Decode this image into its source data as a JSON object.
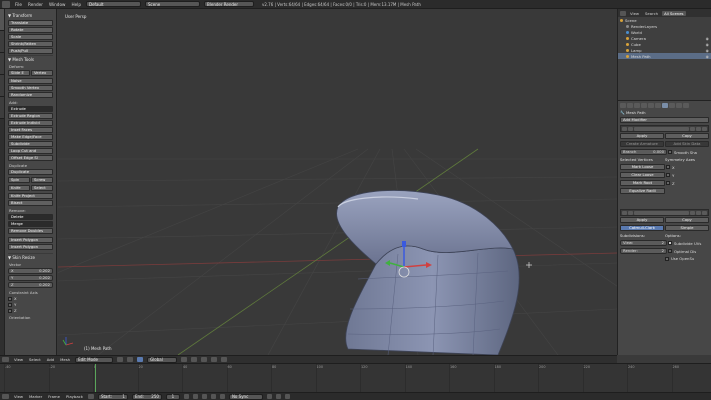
{
  "topbar": {
    "menus": [
      "File",
      "Render",
      "Window",
      "Help"
    ],
    "layout": "Default",
    "scene": "Scene",
    "engine": "Blender Render",
    "stats": "v2.76 | Verts:64/64 | Edges:64/64 | Faces:0/0 | Tris:0 | Mem:13.17M | Mesh Path"
  },
  "toolshelf": {
    "sections": {
      "transform": "▼ Transform",
      "mesh_tools": "▼ Mesh Tools",
      "deform": "Deform:",
      "add": "Add:",
      "duplicate": "Duplicate",
      "remove": "Remove:",
      "skin_resize": "▼ Skin Resize",
      "vector": "Vector",
      "constraint": "Constraint Axis",
      "orientation": "Orientation"
    },
    "transform_buttons": [
      "Translate",
      "Rotate",
      "Scale",
      "Shrink/Fatten",
      "Push/Pull"
    ],
    "deform_row1": [
      "Slide E",
      "Vertex"
    ],
    "deform_buttons": [
      "Noise",
      "Smooth Vertex",
      "Randomize"
    ],
    "add_buttons": [
      "Extrude",
      "Extrude Region",
      "Extrude Individ",
      "Inset Faces",
      "Make Edge/Face",
      "Subdivide",
      "Loop Cut and",
      "Offset Edge Sl"
    ],
    "dup_buttons": [
      "Duplicate"
    ],
    "spin_row": [
      "Spin",
      "Screw"
    ],
    "knife_row": [
      "Knife",
      "Select"
    ],
    "knife_buttons": [
      "Knife Project",
      "Bisect"
    ],
    "remove_buttons": [
      "Delete",
      "Merge",
      "Remove Doubles"
    ],
    "other_buttons": [
      "Insert Polygon",
      "Insert Polygon"
    ],
    "vector": [
      {
        "axis": "X",
        "value": "0.202"
      },
      {
        "axis": "Y",
        "value": "0.202"
      },
      {
        "axis": "Z",
        "value": "0.202"
      }
    ],
    "constraint_axes": [
      "X",
      "Y",
      "Z"
    ]
  },
  "viewport": {
    "view_label": "User Persp",
    "object_label": "(1) Mesh Path"
  },
  "outliner": {
    "tabs": [
      "View",
      "Search",
      "All Scenes"
    ],
    "rows": [
      {
        "label": "Scene",
        "sel": false
      },
      {
        "label": "RenderLayers",
        "sel": false
      },
      {
        "label": "World",
        "sel": false
      },
      {
        "label": "Camera",
        "sel": false
      },
      {
        "label": "Cube",
        "sel": false
      },
      {
        "label": "Lamp",
        "sel": false
      },
      {
        "label": "Mesh Path",
        "sel": true
      }
    ]
  },
  "properties": {
    "object_name": "Mesh Path",
    "add_modifier": "Add Modifier",
    "skin": {
      "apply": "Apply",
      "copy": "Copy",
      "create_armature": "Create Armature",
      "add_skin_data": "Add Skin Data",
      "branch_label": "Branch",
      "branch_value": "0.000",
      "smooth_shading": "Smooth Sha",
      "selected_vertices": "Selected Vertices",
      "symmetry_axes": "Symmetry Axes",
      "mark_loose": "Mark Loose",
      "clear_loose": "Clear Loose",
      "mark_root": "Mark Root",
      "equalize_radii": "Equalize Radii",
      "axes": [
        "X",
        "Y",
        "Z"
      ]
    },
    "subsurf": {
      "apply": "Apply",
      "copy": "Copy",
      "catmull": "Catmull-Clark",
      "simple": "Simple",
      "subdivisions": "Subdivisions:",
      "options": "Options:",
      "view_label": "View:",
      "view_value": "2",
      "render_label": "Render:",
      "render_value": "2",
      "subdivide_uvs": "Subdivide UVs",
      "optimal_display": "Optimal Dis",
      "use_opensubdiv": "Use OpenSu"
    }
  },
  "header3d": {
    "menus": [
      "View",
      "Select",
      "Add",
      "Mesh"
    ],
    "mode": "Edit Mode",
    "orientation": "Global"
  },
  "timeline": {
    "ticks": [
      "-40",
      "-20",
      "0",
      "20",
      "40",
      "60",
      "80",
      "100",
      "120",
      "140",
      "160",
      "180",
      "200",
      "220",
      "240",
      "260"
    ],
    "menus": [
      "View",
      "Marker",
      "Frame",
      "Playback"
    ],
    "start_label": "Start:",
    "start_value": "1",
    "end_label": "End:",
    "end_value": "250",
    "current": "1",
    "sync": "No Sync"
  }
}
